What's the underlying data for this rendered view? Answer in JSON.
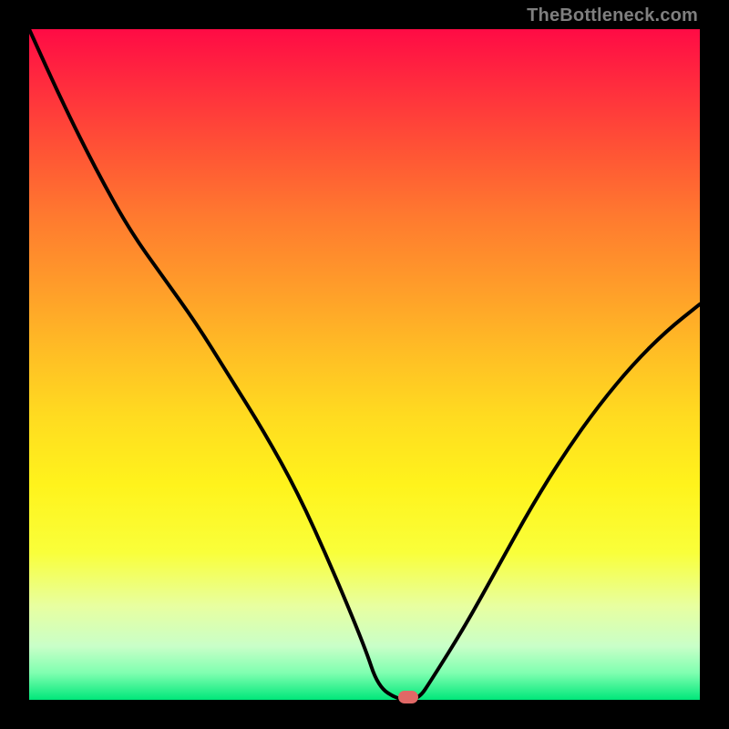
{
  "watermark": "TheBottleneck.com",
  "colors": {
    "frame": "#000000",
    "gradient_top": "#ff0b45",
    "gradient_bottom": "#00e77a",
    "curve": "#000000",
    "marker": "#e06866",
    "watermark_text": "#7f7f7f"
  },
  "chart_data": {
    "type": "line",
    "title": "",
    "xlabel": "",
    "ylabel": "",
    "xlim": [
      0,
      100
    ],
    "ylim": [
      0,
      100
    ],
    "x": [
      0,
      5,
      10,
      15,
      20,
      25,
      30,
      35,
      40,
      45,
      50,
      52,
      55,
      58,
      60,
      65,
      70,
      75,
      80,
      85,
      90,
      95,
      100
    ],
    "values": [
      100,
      89,
      79,
      70,
      63,
      56,
      48,
      40,
      31,
      20,
      8,
      2,
      0,
      0,
      3,
      11,
      20,
      29,
      37,
      44,
      50,
      55,
      59
    ],
    "marker": {
      "x": 56.5,
      "y": 0
    },
    "notes": "V-shaped bottleneck curve; minimum (optimal match) around x≈55–58. Values estimated from pixel positions; no axes or tick labels are rendered."
  }
}
